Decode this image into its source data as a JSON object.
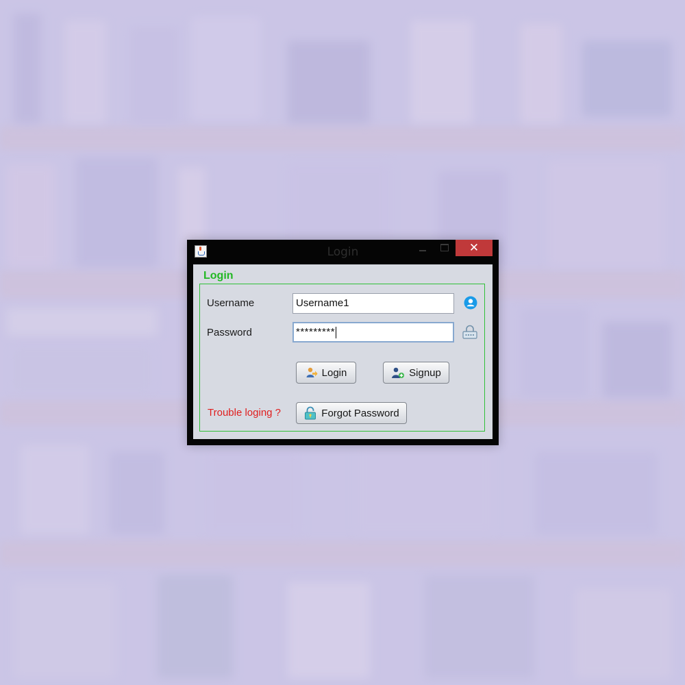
{
  "window": {
    "title": "Login",
    "close_symbol": "✕"
  },
  "panel": {
    "title": "Login"
  },
  "form": {
    "username_label": "Username",
    "username_value": "Username1",
    "password_label": "Password",
    "password_value": "*********",
    "username_icon": "user-circle-icon",
    "password_icon": "padlock-icon"
  },
  "buttons": {
    "login_label": "Login",
    "signup_label": "Signup",
    "forgot_label": "Forgot Password"
  },
  "footer": {
    "trouble_text": "Trouble loging ?"
  },
  "colors": {
    "accent_green": "#22b823",
    "group_border": "#2fc036",
    "warning_red": "#e01e1e",
    "close_button": "#c0393a",
    "user_icon_blue": "#1a9be8"
  }
}
